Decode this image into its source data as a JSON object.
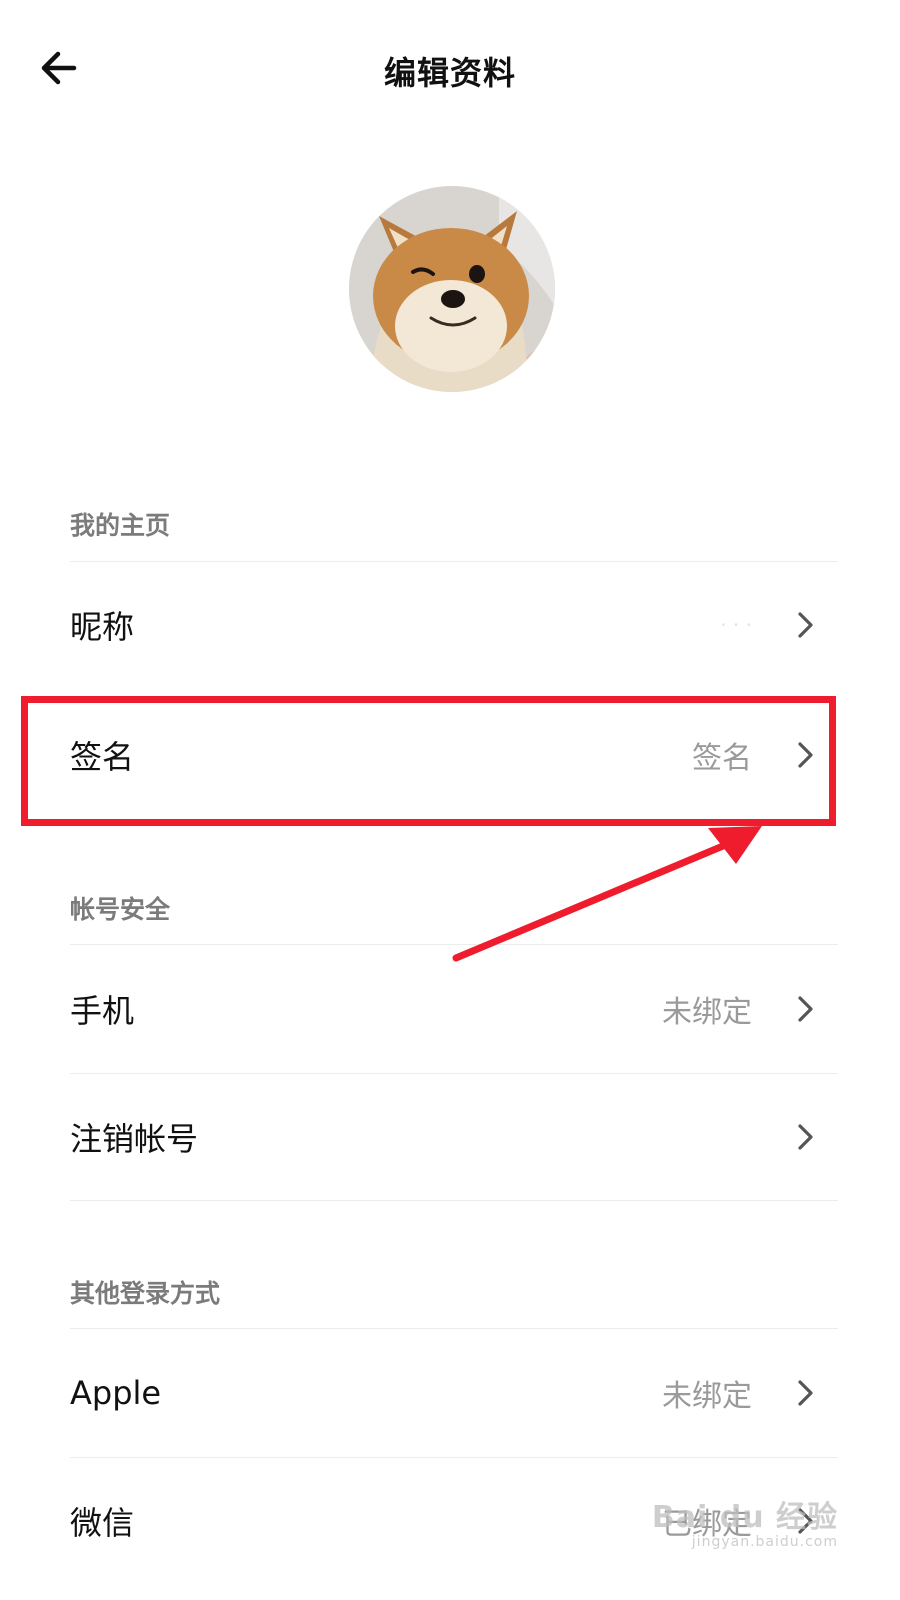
{
  "header": {
    "title": "编辑资料"
  },
  "sections": {
    "profile": "我的主页",
    "account": "帐号安全",
    "login": "其他登录方式"
  },
  "rows": {
    "nickname": {
      "label": "昵称",
      "value": "· · ·"
    },
    "signature": {
      "label": "签名",
      "value": "签名"
    },
    "phone": {
      "label": "手机",
      "value": "未绑定"
    },
    "deactivate": {
      "label": "注销帐号",
      "value": ""
    },
    "apple": {
      "label": "Apple",
      "value": "未绑定"
    },
    "wechat": {
      "label": "微信",
      "value": "已绑定"
    }
  },
  "watermark": {
    "main": "Bai du 经验",
    "sub": "jingyan.baidu.com"
  },
  "colors": {
    "annotation": "#ee1c2c",
    "secondary_text": "#9a9a9a",
    "section_text": "#7b7b7b"
  },
  "icons": {
    "back": "arrow-left-icon",
    "chevron": "chevron-right-icon"
  }
}
